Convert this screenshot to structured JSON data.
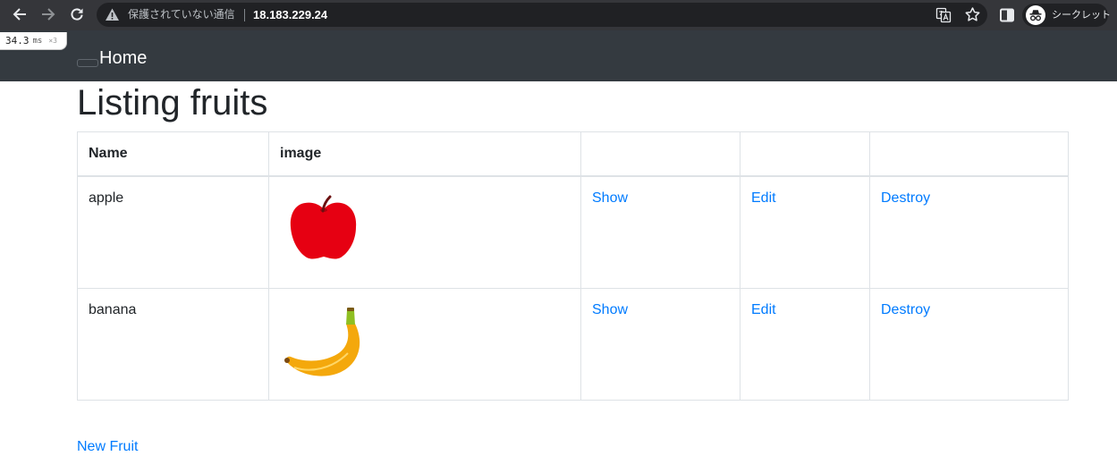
{
  "browser": {
    "security_label": "保護されていない通信",
    "url": "18.183.229.24",
    "profile_label": "シークレット",
    "icons": {
      "back": "back-arrow-icon",
      "forward": "forward-arrow-icon",
      "reload": "reload-icon",
      "security": "warning-triangle-icon",
      "translate": "translate-icon",
      "bookmark": "star-icon",
      "side_panel": "side-panel-icon",
      "profile": "incognito-icon"
    }
  },
  "profiler": {
    "time": "34.3",
    "unit": "ms",
    "count": "×3"
  },
  "navbar": {
    "brand": "Home"
  },
  "page": {
    "title": "Listing fruits"
  },
  "table": {
    "headers": [
      "Name",
      "image",
      "",
      "",
      ""
    ],
    "rows": [
      {
        "name": "apple",
        "image": "apple-image",
        "show": "Show",
        "edit": "Edit",
        "destroy": "Destroy"
      },
      {
        "name": "banana",
        "image": "banana-image",
        "show": "Show",
        "edit": "Edit",
        "destroy": "Destroy"
      }
    ]
  },
  "actions": {
    "new_fruit": "New Fruit"
  },
  "colors": {
    "toolbar": "#35363a",
    "omnibox": "#202124",
    "navbar": "#343a40",
    "link": "#007bff",
    "text": "#212529",
    "border": "#dee2e6",
    "apple": "#e60012",
    "banana": "#f4a80c"
  }
}
